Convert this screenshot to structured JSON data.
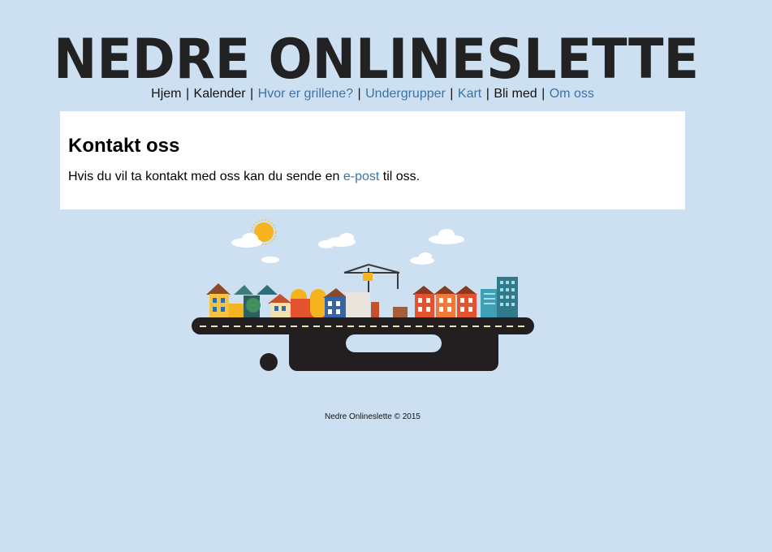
{
  "site": {
    "logo_text": "NEDRE ONLINESLETTE"
  },
  "nav": {
    "items": [
      {
        "label": "Hjem",
        "link": false
      },
      {
        "label": "Kalender",
        "link": false
      },
      {
        "label": "Hvor er grillene?",
        "link": true
      },
      {
        "label": "Undergrupper",
        "link": true
      },
      {
        "label": "Kart",
        "link": true
      },
      {
        "label": "Bli med",
        "link": false
      },
      {
        "label": "Om oss",
        "link": true
      }
    ],
    "separator": "|"
  },
  "content": {
    "heading": "Kontakt oss",
    "text_before": "Hvis du vil ta kontakt med oss kan du sende en ",
    "link_text": "e-post",
    "text_after": " til oss."
  },
  "footer": {
    "text": "Nedre Onlineslette © 2015"
  },
  "colors": {
    "background": "#cde0f2",
    "link": "#3d72a6",
    "logo": "#222222",
    "road": "#231f20"
  }
}
